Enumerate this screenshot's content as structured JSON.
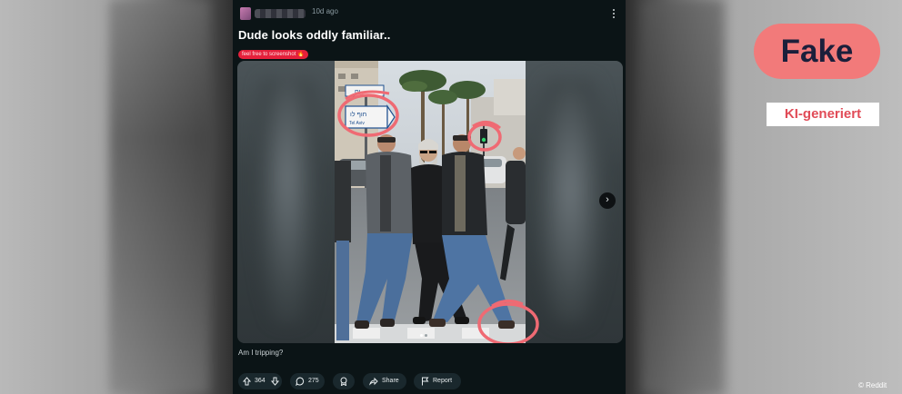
{
  "post": {
    "timestamp": "10d ago",
    "title": "Dude looks oddly familiar..",
    "flair": "feel free to screenshot 🔥",
    "caption": "Am I tripping?",
    "image_signs": {
      "line1": "ים",
      "line2": "חוף לו",
      "line3": "Tel Aviv"
    },
    "actions": {
      "vote_count": "364",
      "comment_count": "275",
      "share_label": "Share",
      "report_label": "Report"
    },
    "gallery": {
      "current": 1,
      "total": 2
    },
    "icons": [
      "upvote-icon",
      "downvote-icon",
      "comment-icon",
      "award-icon",
      "share-icon",
      "report-icon",
      "more-icon",
      "chevron-right-icon"
    ]
  },
  "overlay": {
    "verdict": "Fake",
    "tag": "KI-generiert",
    "credit": "© Reddit"
  },
  "colors": {
    "post_bg": "#0b1416",
    "flair_bg": "#e5203b",
    "verdict_bg": "#f27a7a",
    "verdict_text": "#1b1f3b",
    "tag_text": "#e14b57",
    "annotation_circle": "#ef6a73",
    "action_pill": "#1a282d"
  }
}
